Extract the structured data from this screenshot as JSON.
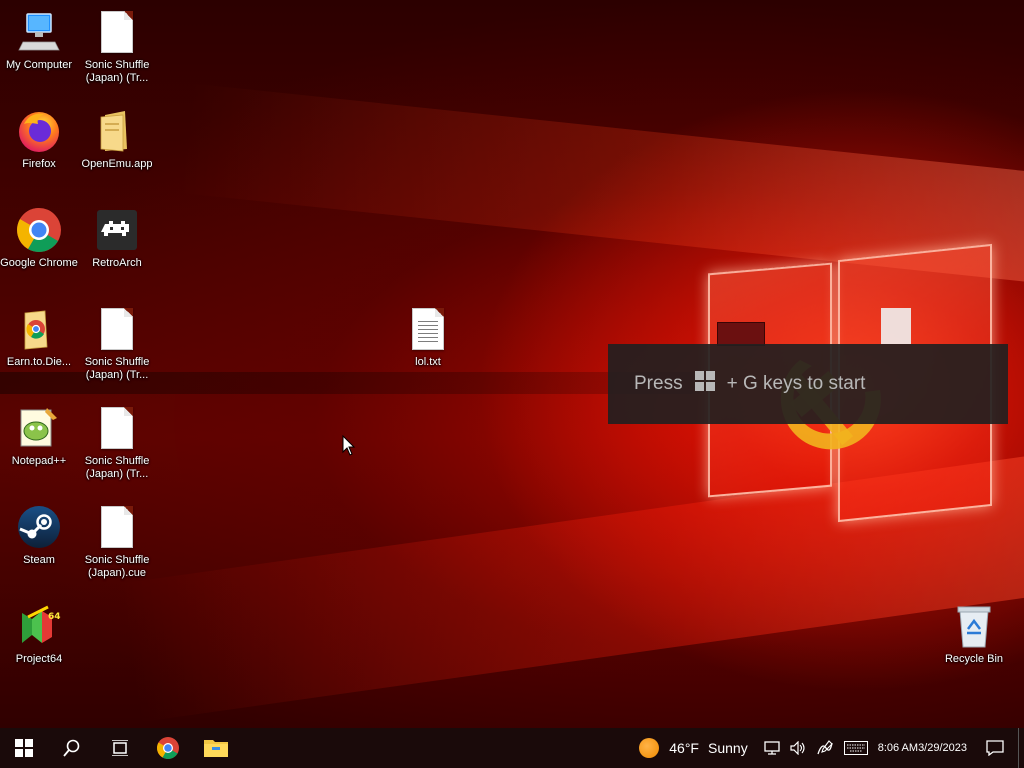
{
  "desktop": {
    "icons": [
      {
        "name": "my-computer",
        "label": "My Computer"
      },
      {
        "name": "sonic-shuffle-1",
        "label": "Sonic Shuffle (Japan) (Tr..."
      },
      {
        "name": "firefox",
        "label": "Firefox"
      },
      {
        "name": "openemu",
        "label": "OpenEmu.app"
      },
      {
        "name": "google-chrome",
        "label": "Google Chrome"
      },
      {
        "name": "retroarch",
        "label": "RetroArch"
      },
      {
        "name": "earn-to-die",
        "label": "Earn.to.Die..."
      },
      {
        "name": "sonic-shuffle-2",
        "label": "Sonic Shuffle (Japan) (Tr..."
      },
      {
        "name": "lol-txt",
        "label": "lol.txt"
      },
      {
        "name": "notepad-plus-plus",
        "label": "Notepad++"
      },
      {
        "name": "sonic-shuffle-3",
        "label": "Sonic Shuffle (Japan) (Tr..."
      },
      {
        "name": "steam",
        "label": "Steam"
      },
      {
        "name": "sonic-shuffle-cue",
        "label": "Sonic Shuffle (Japan).cue"
      },
      {
        "name": "project64",
        "label": "Project64"
      },
      {
        "name": "recycle-bin",
        "label": "Recycle Bin"
      }
    ]
  },
  "toast": {
    "press": "Press",
    "rest": "+ G keys to start"
  },
  "taskbar": {
    "weather": {
      "temp": "46°F",
      "condition": "Sunny"
    },
    "clock": {
      "time": "8:06 AM",
      "date": "3/29/2023"
    }
  },
  "colors": {
    "taskbar_bg": "#1a0a0a",
    "wallpaper_accent": "#e01000"
  }
}
